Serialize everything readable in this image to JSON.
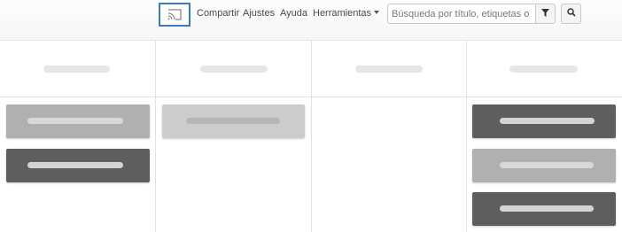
{
  "toolbar": {
    "cast_icon": "cast-icon",
    "nav": {
      "compartir": "Compartir",
      "ajustes": "Ajustes",
      "ayuda": "Ayuda",
      "herramientas": "Herramientas"
    },
    "search": {
      "placeholder": "Búsqueda por título, etiquetas o no",
      "value": "",
      "filter_icon": "filter-icon",
      "search_icon": "search-icon"
    }
  },
  "board": {
    "columns": [
      {
        "cards": [
          "placeholder",
          "placeholder"
        ]
      },
      {
        "cards": [
          "placeholder"
        ]
      },
      {
        "cards": []
      },
      {
        "cards": [
          "placeholder",
          "placeholder",
          "placeholder"
        ]
      }
    ]
  },
  "colors": {
    "accent": "#3a7cc1",
    "card_dark": "#5e5e5e",
    "card_mid": "#b0b0b0",
    "card_light": "#cccccc"
  }
}
